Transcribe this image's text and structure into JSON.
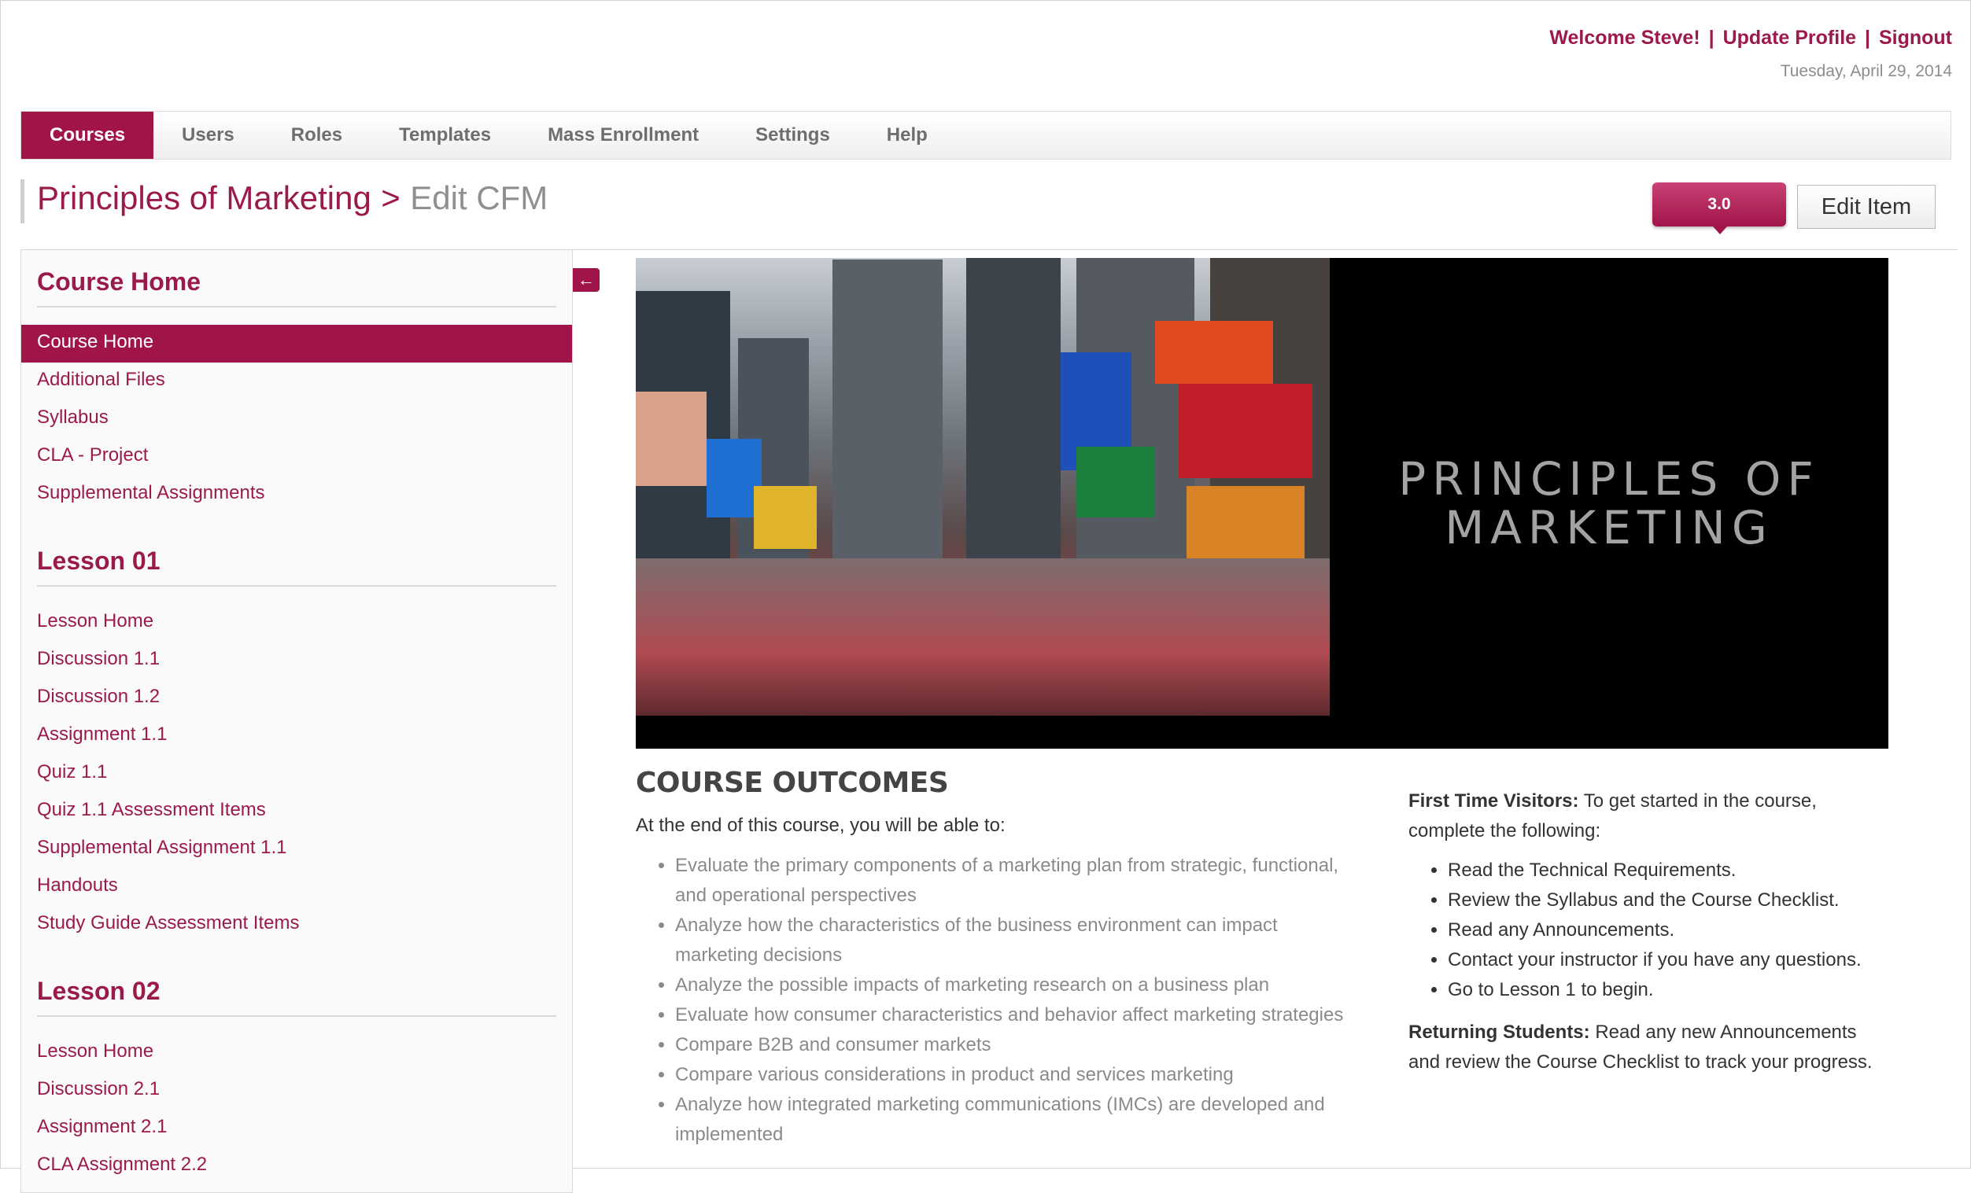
{
  "header": {
    "welcome": "Welcome Steve!",
    "update_profile": "Update Profile",
    "signout": "Signout",
    "separator": "|",
    "date": "Tuesday, April 29, 2014"
  },
  "nav": {
    "items": [
      {
        "label": "Courses",
        "active": true
      },
      {
        "label": "Users"
      },
      {
        "label": "Roles"
      },
      {
        "label": "Templates"
      },
      {
        "label": "Mass Enrollment"
      },
      {
        "label": "Settings"
      },
      {
        "label": "Help"
      }
    ]
  },
  "breadcrumb": {
    "course": "Principles of Marketing",
    "separator": ">",
    "page": "Edit CFM"
  },
  "toolbar": {
    "version": "3.0",
    "edit_label": "Edit Item"
  },
  "sidebar": {
    "sections": [
      {
        "title": "Course Home",
        "items": [
          "Course Home",
          "Additional Files",
          "Syllabus",
          "CLA - Project",
          "Supplemental Assignments"
        ]
      },
      {
        "title": "Lesson 01",
        "items": [
          "Lesson Home",
          "Discussion 1.1",
          "Discussion 1.2",
          "Assignment 1.1",
          "Quiz 1.1",
          "Quiz 1.1 Assessment Items",
          "Supplemental Assignment 1.1",
          "Handouts",
          "Study Guide Assessment Items"
        ]
      },
      {
        "title": "Lesson 02",
        "items": [
          "Lesson Home",
          "Discussion 2.1",
          "Assignment 2.1",
          "CLA Assignment 2.2"
        ]
      }
    ],
    "collapse_icon": "arrow-left-icon"
  },
  "banner": {
    "title_line1": "PRINCIPLES OF",
    "title_line2": "MARKETING"
  },
  "outcomes": {
    "heading": "COURSE OUTCOMES",
    "intro": "At the end of this course, you will be able to:",
    "items": [
      "Evaluate the primary components of a marketing plan from strategic, functional, and operational perspectives",
      "Analyze how the characteristics of the business environment can impact marketing decisions",
      "Analyze the possible impacts of marketing research on a business plan",
      "Evaluate how consumer characteristics and behavior affect marketing strategies",
      "Compare B2B and consumer markets",
      "Compare various considerations in product and services marketing",
      "Analyze how integrated marketing communications (IMCs) are developed and implemented"
    ]
  },
  "visitors": {
    "first_label": "First Time Visitors:",
    "first_text": " To get started in the course, complete the following:",
    "steps": [
      "Read the Technical Requirements.",
      "Review the Syllabus and the Course Checklist.",
      "Read any Announcements.",
      "Contact your instructor if you have any questions.",
      "Go to Lesson 1 to begin."
    ],
    "returning_label": "Returning Students:",
    "returning_text": " Read any new Announcements and review the Course Checklist to track your progress."
  },
  "colors": {
    "accent": "#a0144a",
    "link": "#9b1a4c"
  }
}
